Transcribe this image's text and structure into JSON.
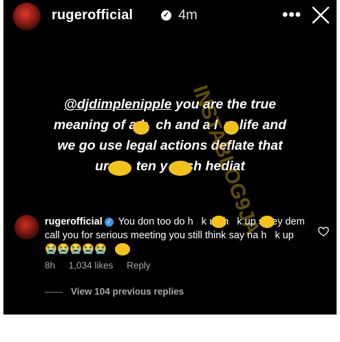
{
  "header": {
    "username": "rugerofficial",
    "time": "4m",
    "verified_glyph": "✓",
    "more_glyph": "•••",
    "icons": [
      "verified-badge-icon",
      "more-options-icon",
      "close-icon"
    ]
  },
  "story": {
    "mention": "@djdimplenipple",
    "line1_rest": " you are the true",
    "line2": "meaning of a b  ch and a l  w life and",
    "line3": "we go use legal actions deflate that",
    "line4": "ur r     ten y     sh hediat"
  },
  "watermark": "INSTABLOG9JA",
  "comment": {
    "username": "rugerofficial",
    "verified_glyph": "✓",
    "text": "You don too do h   k up h   k up sotey dem call you for serious meeting you still think say na h   k up 😭😭😭😭😭",
    "time": "8h",
    "likes": "1,034 likes",
    "reply": "Reply",
    "icons": [
      "heart-icon"
    ]
  },
  "replies": {
    "label": "View 104 previous replies"
  },
  "colors": {
    "background": "#000000",
    "text": "#ffffff",
    "muted": "#a8a8a8",
    "censor": "#f2c21b",
    "verified_blue": "#3897f0"
  }
}
